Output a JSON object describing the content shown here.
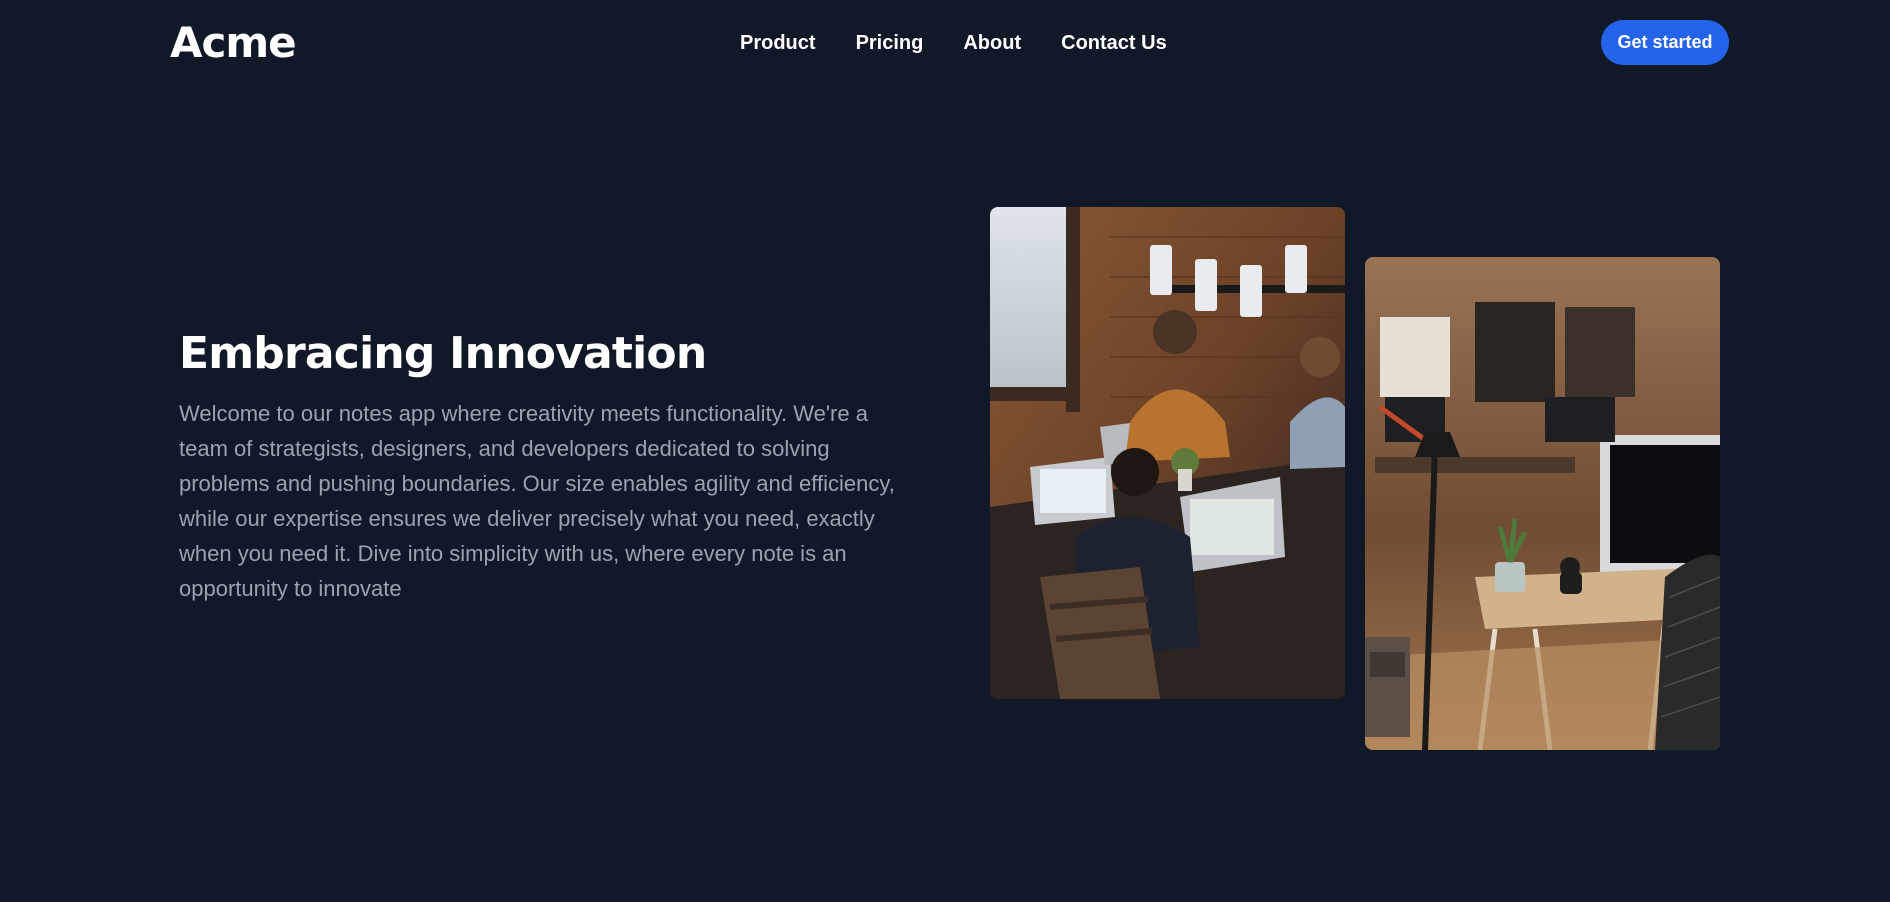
{
  "header": {
    "logo": "Acme",
    "nav": [
      {
        "label": "Product"
      },
      {
        "label": "Pricing"
      },
      {
        "label": "About"
      },
      {
        "label": "Contact Us"
      }
    ],
    "cta_label": "Get started"
  },
  "hero": {
    "title": "Embracing Innovation",
    "body": "Welcome to our notes app where creativity meets functionality. We're a team of strategists, designers, and developers dedicated to solving problems and pushing boundaries. Our size enables agility and efficiency, while our expertise ensures we deliver precisely what you need, exactly when you need it. Dive into simplicity with us, where every note is an opportunity to innovate"
  },
  "photos": [
    {
      "icon": "team-meeting-photo"
    },
    {
      "icon": "office-workspace-photo"
    }
  ],
  "colors": {
    "background": "#111827",
    "accent": "#2563eb",
    "body_text": "#9ca3af"
  }
}
